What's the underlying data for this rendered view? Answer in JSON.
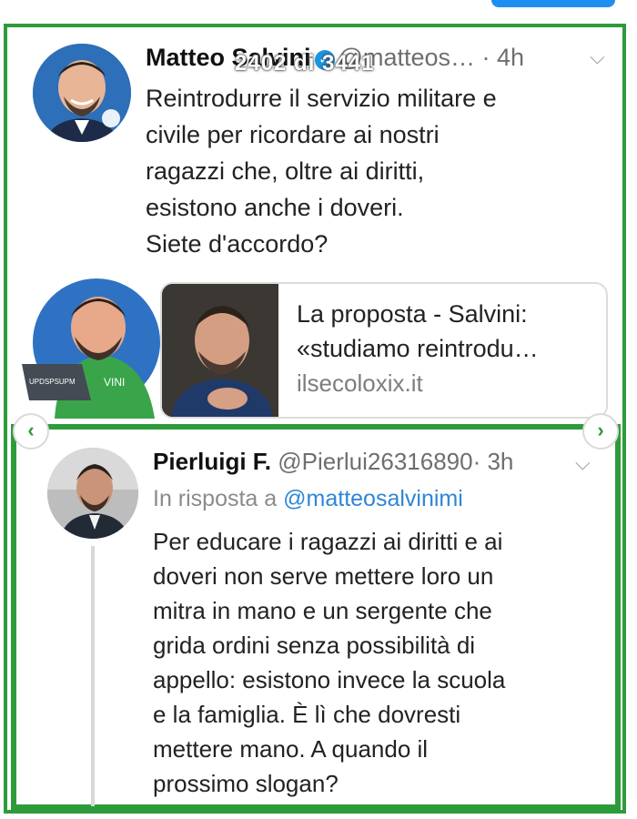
{
  "overlay": {
    "counter": "2402 di 3441"
  },
  "tweet": {
    "author_name": "Matteo Salvini",
    "handle": "@matteos…",
    "time": "· 4h",
    "lines": [
      "Reintrodurre il servizio militare e",
      "civile per ricordare ai nostri",
      "ragazzi che, oltre ai diritti,",
      "esistono anche i doveri.",
      "Siete d'accordo?"
    ]
  },
  "card": {
    "title_line1": "La proposta - Salvini:",
    "title_line2": "«studiamo reintrodu…",
    "domain": "ilsecoloxix.it",
    "caricature_text": "VINI",
    "laptop_text": "UPDSPSUPM"
  },
  "reply": {
    "author_name": "Pierluigi F.",
    "handle": "@Pierlui26316890",
    "time": "· 3h",
    "in_reply_prefix": "In risposta a",
    "in_reply_mention": "@matteosalvinimi",
    "lines": [
      "Per educare i ragazzi ai diritti e ai",
      "doveri non serve mettere loro un",
      "mitra in mano e un sergente che",
      "grida ordini senza possibilità di",
      "appello: esistono invece la scuola",
      "e la famiglia. È lì che dovresti",
      "mettere mano. A quando il",
      "prossimo slogan?"
    ]
  },
  "colors": {
    "frame_green": "#2e9b3a",
    "link_blue": "#2f86d6",
    "verified_blue": "#1b95e0"
  }
}
